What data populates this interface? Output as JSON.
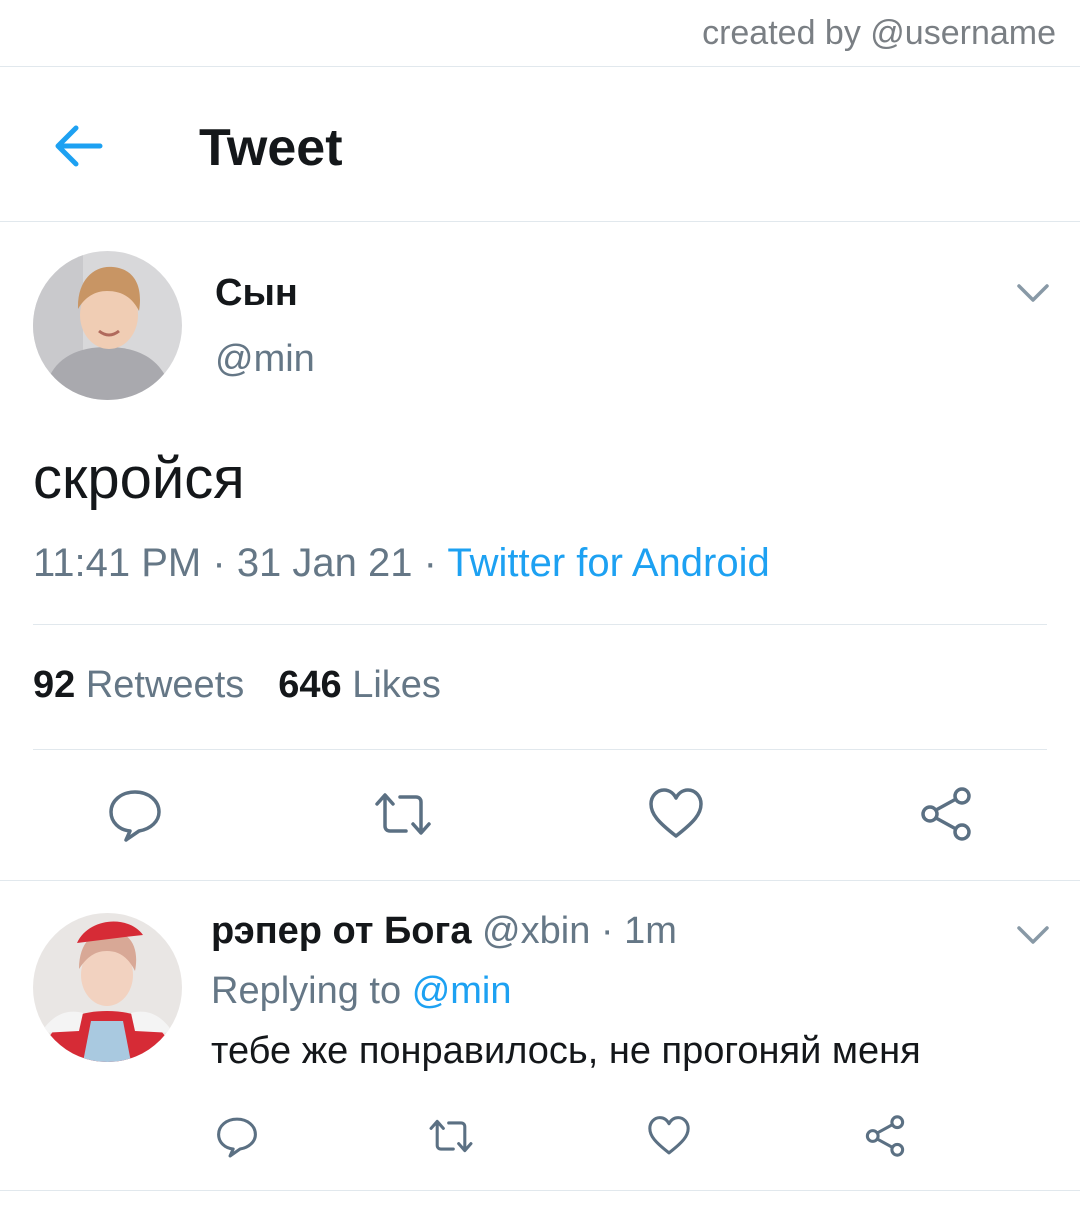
{
  "credit": "created by @username",
  "header": {
    "title": "Tweet"
  },
  "tweet": {
    "author_name": "Сын",
    "author_handle": "@min",
    "text": "скройся",
    "time": "11:41 PM",
    "date": "31 Jan 21",
    "source": "Twitter for Android",
    "retweets_count": "92",
    "retweets_label": "Retweets",
    "likes_count": "646",
    "likes_label": "Likes"
  },
  "reply": {
    "author_name": "рэпер от Бога",
    "author_handle": "@xbin",
    "age": "1m",
    "replying_prefix": "Replying to",
    "replying_to": "@min",
    "text": "тебе же понравилось, не прогоняй меня"
  },
  "colors": {
    "accent": "#1da1f2",
    "muted": "#657786",
    "icon": "#5b7083",
    "divider": "#e1e8ed"
  },
  "icons": [
    "back-arrow-icon",
    "chevron-down-icon",
    "reply-icon",
    "retweet-icon",
    "like-icon",
    "share-icon"
  ]
}
